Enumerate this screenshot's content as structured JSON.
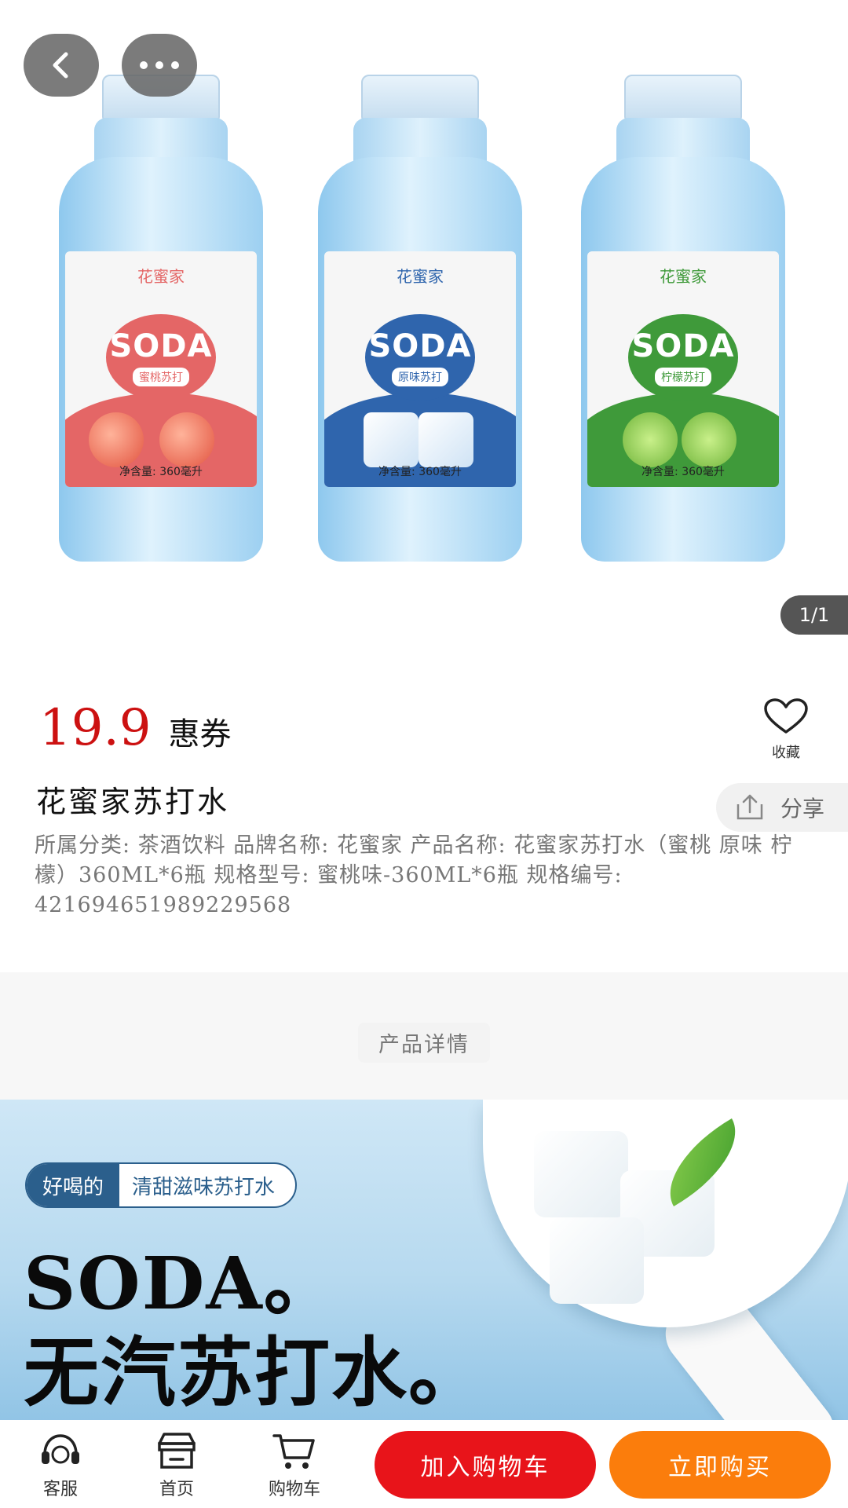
{
  "gallery": {
    "pager": "1/1",
    "products": [
      {
        "brand": "花蜜家",
        "badge_text": "SODA",
        "flavor": "蜜桃苏打",
        "net": "净含量: 360毫升"
      },
      {
        "brand": "花蜜家",
        "badge_text": "SODA",
        "flavor": "原味苏打",
        "net": "净含量: 360毫升"
      },
      {
        "brand": "花蜜家",
        "badge_text": "SODA",
        "flavor": "柠檬苏打",
        "net": "净含量: 360毫升"
      }
    ],
    "icons": {
      "back": "chevron-left-icon",
      "more": "more-dots-icon"
    }
  },
  "product": {
    "price": "19.9",
    "coupon": "惠券",
    "favorite_label": "收藏",
    "title": "花蜜家苏打水",
    "share_label": "分享",
    "description": "所属分类: 茶酒饮料 品牌名称: 花蜜家 产品名称: 花蜜家苏打水（蜜桃 原味 柠檬）360ML*6瓶 规格型号: 蜜桃味-360ML*6瓶 规格编号: 4216946519892​29568"
  },
  "details": {
    "heading": "产品详情",
    "banner": {
      "tag_left": "好喝的",
      "tag_right": "清甜滋味苏打水",
      "headline_en": "SODA。",
      "headline_cn": "无汽苏打水。"
    }
  },
  "bottom_bar": {
    "service_label": "客服",
    "home_label": "首页",
    "cart_label": "购物车",
    "add_to_cart": "加入购物车",
    "buy_now": "立即购买"
  },
  "colors": {
    "price": "#cc1111",
    "add_to_cart_bg": "#e8141a",
    "buy_now_bg": "#fb7d0c",
    "peach": "#e46666",
    "original": "#2f65ad",
    "lemon": "#3f9a3a"
  }
}
